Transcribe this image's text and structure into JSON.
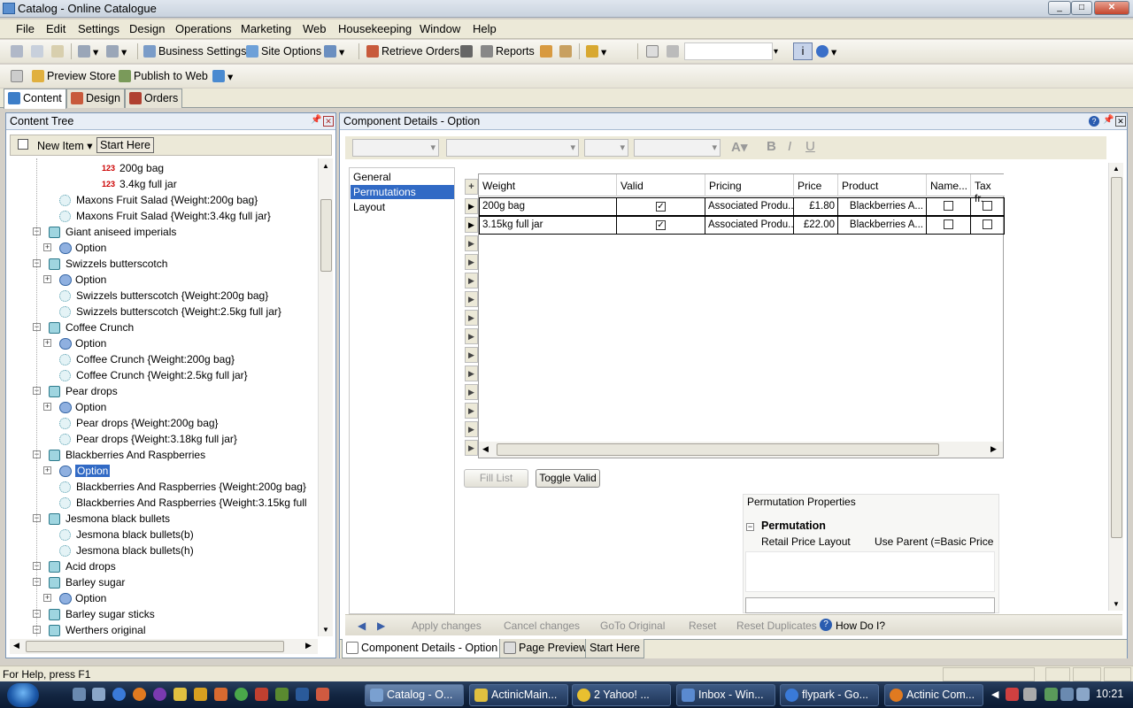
{
  "window": {
    "title": "Catalog - Online Catalogue",
    "controls": [
      "_",
      "□",
      "✕"
    ]
  },
  "menu": [
    "File",
    "Edit",
    "Settings",
    "Design",
    "Operations",
    "Marketing",
    "Web",
    "Housekeeping",
    "Window",
    "Help"
  ],
  "toolbar": {
    "business_settings": "Business Settings",
    "site_options": "Site Options",
    "retrieve_orders": "Retrieve Orders",
    "reports": "Reports",
    "preview_store": "Preview Store",
    "publish_to_web": "Publish to Web"
  },
  "main_tabs": [
    "Content",
    "Design",
    "Orders"
  ],
  "content_tree": {
    "title": "Content Tree",
    "new_item": "New Item",
    "start_here": "Start Here",
    "nodes": [
      {
        "label": "200g bag",
        "type": "num"
      },
      {
        "label": "3.4kg full jar",
        "type": "num"
      },
      {
        "label": "Maxons Fruit Salad {Weight:200g bag}",
        "type": "variant"
      },
      {
        "label": "Maxons Fruit Salad {Weight:3.4kg full jar}",
        "type": "variant"
      },
      {
        "label": "Giant aniseed imperials",
        "type": "product"
      },
      {
        "label": "Option",
        "type": "option"
      },
      {
        "label": "Swizzels butterscotch",
        "type": "product"
      },
      {
        "label": "Option",
        "type": "option"
      },
      {
        "label": "Swizzels butterscotch  {Weight:200g bag}",
        "type": "variant"
      },
      {
        "label": "Swizzels butterscotch  {Weight:2.5kg full jar}",
        "type": "variant"
      },
      {
        "label": "Coffee Crunch",
        "type": "product"
      },
      {
        "label": "Option",
        "type": "option"
      },
      {
        "label": "Coffee Crunch {Weight:200g bag}",
        "type": "variant"
      },
      {
        "label": "Coffee Crunch {Weight:2.5kg full jar}",
        "type": "variant"
      },
      {
        "label": "Pear drops",
        "type": "product"
      },
      {
        "label": "Option",
        "type": "option"
      },
      {
        "label": "Pear drops  {Weight:200g bag}",
        "type": "variant"
      },
      {
        "label": "Pear drops  {Weight:3.18kg full jar}",
        "type": "variant"
      },
      {
        "label": "Blackberries  And Raspberries",
        "type": "product"
      },
      {
        "label": "Option",
        "type": "option",
        "selected": true
      },
      {
        "label": "Blackberries  And Raspberries {Weight:200g bag}",
        "type": "variant"
      },
      {
        "label": "Blackberries  And Raspberries {Weight:3.15kg full",
        "type": "variant"
      },
      {
        "label": "Jesmona black bullets",
        "type": "product"
      },
      {
        "label": "Jesmona black bullets(b)",
        "type": "variant"
      },
      {
        "label": "Jesmona black bullets(h)",
        "type": "variant"
      },
      {
        "label": "Acid drops",
        "type": "product"
      },
      {
        "label": "Barley sugar",
        "type": "product"
      },
      {
        "label": "Option",
        "type": "option"
      },
      {
        "label": "Barley sugar sticks",
        "type": "product"
      },
      {
        "label": "Werthers original",
        "type": "product"
      }
    ]
  },
  "component": {
    "title": "Component Details - Option",
    "nav": [
      "General",
      "Permutations",
      "Layout"
    ],
    "nav_active": "Permutations",
    "grid_headers": [
      "Weight",
      "Valid",
      "Pricing",
      "Price",
      "Product",
      "Name...",
      "Tax fr."
    ],
    "rows": [
      {
        "weight": "200g bag",
        "valid": true,
        "pricing": "Associated Produ...",
        "price": "£1.80",
        "product": "Blackberries  A..."
      },
      {
        "weight": "3.15kg full jar",
        "valid": true,
        "pricing": "Associated Produ...",
        "price": "£22.00",
        "product": "Blackberries  A..."
      }
    ],
    "fill_list": "Fill List",
    "toggle_valid": "Toggle Valid",
    "perm_props": {
      "title": "Permutation Properties",
      "section": "Permutation",
      "key": "Retail Price Layout",
      "value": "Use Parent (=Basic Price In"
    },
    "actions": [
      "Apply changes",
      "Cancel changes",
      "GoTo Original",
      "Reset",
      "Reset Duplicates"
    ],
    "how_do_i": "How Do I?",
    "bottom_tabs": [
      "Component Details - Option",
      "Page Preview",
      "Start Here"
    ]
  },
  "status": {
    "text": "For Help, press F1"
  },
  "taskbar": {
    "tasks": [
      "Catalog - O...",
      "ActinicMain...",
      "2 Yahoo! ...",
      "Inbox - Win...",
      "flypark - Go...",
      "Actinic Com..."
    ],
    "clock": "10:21"
  },
  "colors": {
    "selection": "#316ac5",
    "title_bar": "#c9d3de",
    "taskbar": "#132642"
  }
}
